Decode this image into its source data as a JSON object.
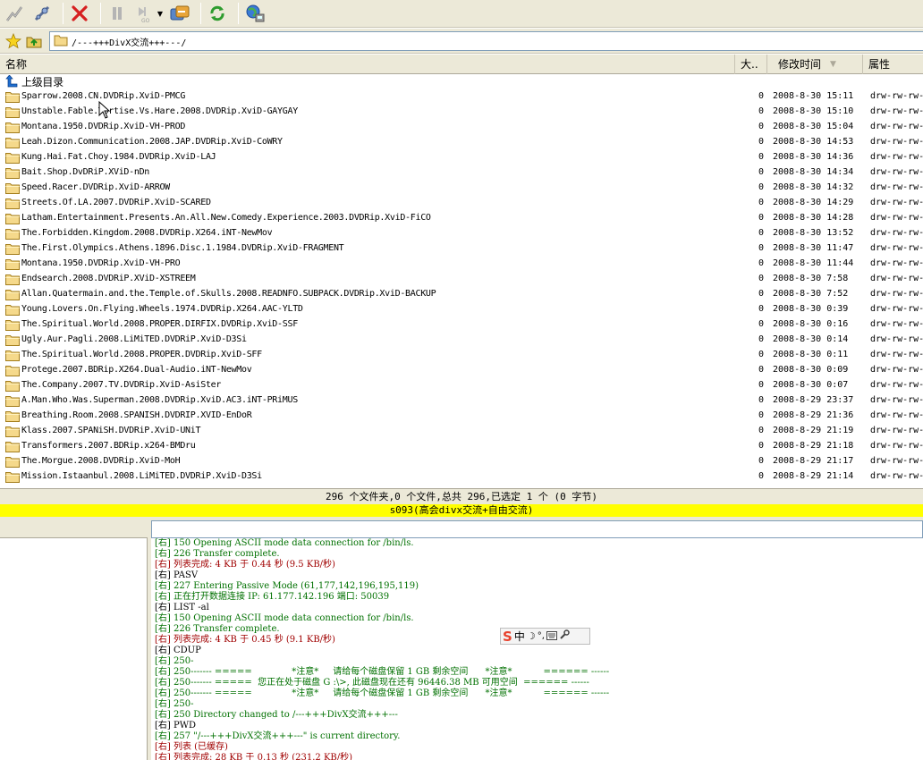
{
  "toolbar": {
    "icons": [
      "connect-icon",
      "quick-connect-icon",
      "disconnect-icon",
      "pause-icon",
      "go-icon",
      "transfer-icon",
      "refresh-icon",
      "site-manager-icon"
    ]
  },
  "address": {
    "path": "/---+++DivX交流+++---/"
  },
  "columns": {
    "name": "名称",
    "size": "大..",
    "modified": "修改时间",
    "attributes": "属性"
  },
  "parent_dir": "上级目录",
  "files": [
    {
      "name": "Sparrow.2008.CN.DVDRip.XviD-PMCG",
      "size": "0",
      "date": "2008-8-30 15:11",
      "attr": "drw-rw-rw-"
    },
    {
      "name": "Unstable.Fable.Tortise.Vs.Hare.2008.DVDRip.XviD-GAYGAY",
      "size": "0",
      "date": "2008-8-30 15:10",
      "attr": "drw-rw-rw-"
    },
    {
      "name": "Montana.1950.DVDRip.XviD-VH-PROD",
      "size": "0",
      "date": "2008-8-30 15:04",
      "attr": "drw-rw-rw-"
    },
    {
      "name": "Leah.Dizon.Communication.2008.JAP.DVDRip.XviD-CoWRY",
      "size": "0",
      "date": "2008-8-30 14:53",
      "attr": "drw-rw-rw-"
    },
    {
      "name": "Kung.Hai.Fat.Choy.1984.DVDRip.XviD-LAJ",
      "size": "0",
      "date": "2008-8-30 14:36",
      "attr": "drw-rw-rw-"
    },
    {
      "name": "Bait.Shop.DvDRiP.XViD-nDn",
      "size": "0",
      "date": "2008-8-30 14:34",
      "attr": "drw-rw-rw-"
    },
    {
      "name": "Speed.Racer.DVDRip.XviD-ARROW",
      "size": "0",
      "date": "2008-8-30 14:32",
      "attr": "drw-rw-rw-"
    },
    {
      "name": "Streets.Of.LA.2007.DVDRiP.XviD-SCARED",
      "size": "0",
      "date": "2008-8-30 14:29",
      "attr": "drw-rw-rw-"
    },
    {
      "name": "Latham.Entertainment.Presents.An.All.New.Comedy.Experience.2003.DVDRip.XviD-FiCO",
      "size": "0",
      "date": "2008-8-30 14:28",
      "attr": "drw-rw-rw-"
    },
    {
      "name": "The.Forbidden.Kingdom.2008.DVDRip.X264.iNT-NewMov",
      "size": "0",
      "date": "2008-8-30 13:52",
      "attr": "drw-rw-rw-"
    },
    {
      "name": "The.First.Olympics.Athens.1896.Disc.1.1984.DVDRip.XviD-FRAGMENT",
      "size": "0",
      "date": "2008-8-30 11:47",
      "attr": "drw-rw-rw-"
    },
    {
      "name": "Montana.1950.DVDRip.XviD-VH-PRO",
      "size": "0",
      "date": "2008-8-30 11:44",
      "attr": "drw-rw-rw-"
    },
    {
      "name": "Endsearch.2008.DVDRiP.XViD-XSTREEM",
      "size": "0",
      "date": "2008-8-30 7:58",
      "attr": "drw-rw-rw-"
    },
    {
      "name": "Allan.Quatermain.and.the.Temple.of.Skulls.2008.READNFO.SUBPACK.DVDRip.XviD-BACKUP",
      "size": "0",
      "date": "2008-8-30 7:52",
      "attr": "drw-rw-rw-"
    },
    {
      "name": "Young.Lovers.On.Flying.Wheels.1974.DVDRip.X264.AAC-YLTD",
      "size": "0",
      "date": "2008-8-30 0:39",
      "attr": "drw-rw-rw-"
    },
    {
      "name": "The.Spiritual.World.2008.PROPER.DIRFIX.DVDRip.XviD-SSF",
      "size": "0",
      "date": "2008-8-30 0:16",
      "attr": "drw-rw-rw-"
    },
    {
      "name": "Ugly.Aur.Pagli.2008.LiMiTED.DVDRiP.XviD-D3Si",
      "size": "0",
      "date": "2008-8-30 0:14",
      "attr": "drw-rw-rw-"
    },
    {
      "name": "The.Spiritual.World.2008.PROPER.DVDRip.XviD-SFF",
      "size": "0",
      "date": "2008-8-30 0:11",
      "attr": "drw-rw-rw-"
    },
    {
      "name": "Protege.2007.BDRip.X264.Dual-Audio.iNT-NewMov",
      "size": "0",
      "date": "2008-8-30 0:09",
      "attr": "drw-rw-rw-"
    },
    {
      "name": "The.Company.2007.TV.DVDRip.XviD-AsiSter",
      "size": "0",
      "date": "2008-8-30 0:07",
      "attr": "drw-rw-rw-"
    },
    {
      "name": "A.Man.Who.Was.Superman.2008.DVDRip.XviD.AC3.iNT-PRiMUS",
      "size": "0",
      "date": "2008-8-29 23:37",
      "attr": "drw-rw-rw-"
    },
    {
      "name": "Breathing.Room.2008.SPANISH.DVDRIP.XVID-EnDoR",
      "size": "0",
      "date": "2008-8-29 21:36",
      "attr": "drw-rw-rw-"
    },
    {
      "name": "Klass.2007.SPANiSH.DVDRiP.XviD-UNiT",
      "size": "0",
      "date": "2008-8-29 21:19",
      "attr": "drw-rw-rw-"
    },
    {
      "name": "Transformers.2007.BDRip.x264-BMDru",
      "size": "0",
      "date": "2008-8-29 21:18",
      "attr": "drw-rw-rw-"
    },
    {
      "name": "The.Morgue.2008.DVDRip.XviD-MoH",
      "size": "0",
      "date": "2008-8-29 21:17",
      "attr": "drw-rw-rw-"
    },
    {
      "name": "Mission.Istaanbul.2008.LiMiTED.DVDRiP.XviD-D3Si",
      "size": "0",
      "date": "2008-8-29 21:14",
      "attr": "drw-rw-rw-"
    }
  ],
  "status": {
    "summary": "296 个文件夹,0 个文件,总共 296,已选定 1 个 (0 字节)",
    "site": "s093(高会divx交流+自由交流)"
  },
  "log": [
    {
      "text": "[右] 150 Opening ASCII mode data connection for /bin/ls.",
      "color": "green"
    },
    {
      "text": "[右] 226 Transfer complete.",
      "color": "green"
    },
    {
      "text": "[右] 列表完成: 4 KB 于 0.44 秒 (9.5 KB/秒)",
      "color": "red"
    },
    {
      "text": "[右] PASV",
      "color": "black"
    },
    {
      "text": "[右] 227 Entering Passive Mode (61,177,142,196,195,119)",
      "color": "green"
    },
    {
      "text": "[右] 正在打开数据连接 IP: 61.177.142.196 端口: 50039",
      "color": "green"
    },
    {
      "text": "[右] LIST -al",
      "color": "black"
    },
    {
      "text": "[右] 150 Opening ASCII mode data connection for /bin/ls.",
      "color": "green"
    },
    {
      "text": "[右] 226 Transfer complete.",
      "color": "green"
    },
    {
      "text": "[右] 列表完成: 4 KB 于 0.45 秒 (9.1 KB/秒)",
      "color": "red"
    },
    {
      "text": "[右] CDUP",
      "color": "black"
    },
    {
      "text": "[右] 250-",
      "color": "green"
    },
    {
      "text": "[右] 250------- =====              *注意*     请给每个磁盘保留 1 GB 剩余空间      *注意*           ====== ------",
      "color": "green"
    },
    {
      "text": "[右] 250------- =====  您正在处于磁盘 G :\\>, 此磁盘现在还有 96446.38 MB 可用空间  ====== ------",
      "color": "green"
    },
    {
      "text": "[右] 250------- =====              *注意*     请给每个磁盘保留 1 GB 剩余空间      *注意*           ====== ------",
      "color": "green"
    },
    {
      "text": "[右] 250-",
      "color": "green"
    },
    {
      "text": "[右] 250 Directory changed to /---+++DivX交流+++---",
      "color": "green"
    },
    {
      "text": "[右] PWD",
      "color": "black"
    },
    {
      "text": "[右] 257 \"/---+++DivX交流+++---\" is current directory.",
      "color": "green"
    },
    {
      "text": "[右] 列表 (已缓存)",
      "color": "red"
    },
    {
      "text": "[右] 列表完成: 28 KB 于 0.13 秒 (231.2 KB/秒)",
      "color": "red"
    }
  ],
  "ime": {
    "label": "中"
  }
}
